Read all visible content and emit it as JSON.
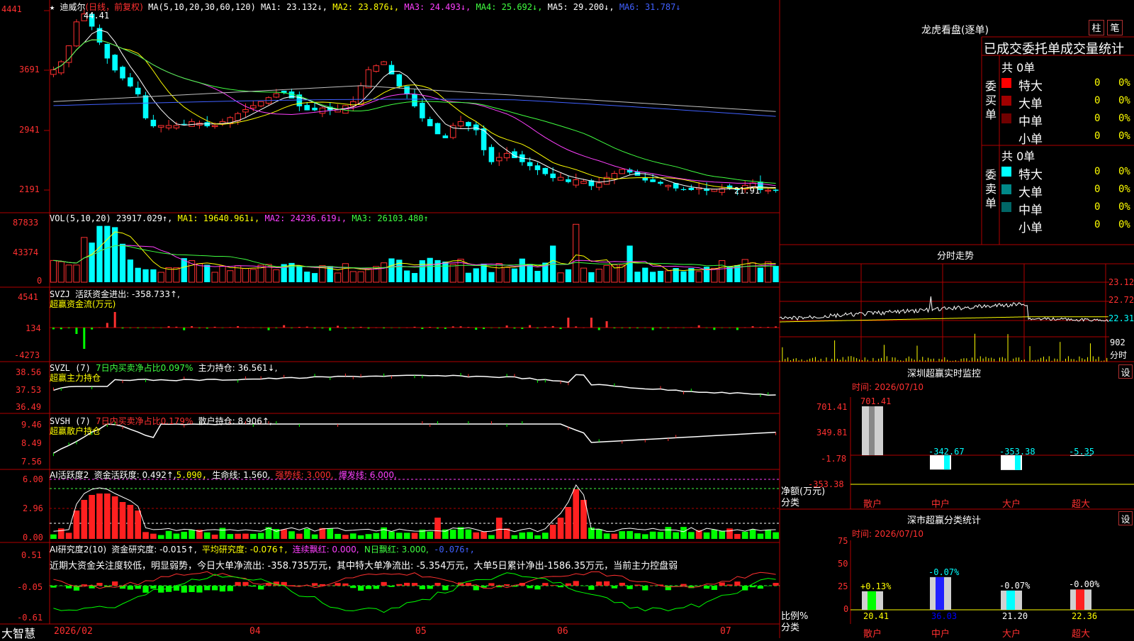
{
  "colors": {
    "up": "#ff3030",
    "down": "#00ffff",
    "grid": "#b00000",
    "bg": "#000000"
  },
  "kline": {
    "header": {
      "star": "★",
      "name": "迪威尔",
      "period": "(日线，前复权)",
      "ma_title": "MA(5,10,20,30,60,120)",
      "ma1": "MA1: 23.132↓,",
      "ma2": "MA2: 23.876↓,",
      "ma3": "MA3: 24.493↓,",
      "ma4": "MA4: 25.692↓,",
      "ma5": "MA5: 29.200↓,",
      "ma6": "MA6: 31.787↓"
    },
    "y_ticks": [
      "4441",
      "3691",
      "2941",
      "2191"
    ],
    "max_label": "44.41",
    "min_label": "21.91"
  },
  "vol": {
    "title": "VOL(5,10,20)",
    "v": "23917.029↑,",
    "ma1": "MA1: 19640.961↓,",
    "ma2": "MA2: 24236.619↓,",
    "ma3": "MA3: 26103.480↑",
    "y_ticks": [
      "87833",
      "43374",
      "0"
    ]
  },
  "svzj": {
    "title": "SVZJ",
    "desc": "活跃资金进出: -358.733↑,",
    "sub": "超赢资金流(万元)",
    "y_ticks": [
      "4541",
      "134",
      "-4273"
    ]
  },
  "svzl": {
    "title": "SVZL (7)",
    "a": "7日内买卖净占比0.097%",
    "b": "主力持仓: 36.561↓,",
    "sub": "超赢主力持仓",
    "y_ticks": [
      "38.56",
      "37.53",
      "36.49"
    ]
  },
  "svsh": {
    "title": "SVSH (7)",
    "a": "7日内买卖净占比0.179%",
    "b": "散户持仓: 8.906↑,",
    "sub": "超赢散户持仓",
    "y_ticks": [
      "9.46",
      "8.49",
      "7.56"
    ]
  },
  "ai2": {
    "title": "AI活跃度2",
    "a": "资金活跃度: 0.492↑,",
    "b": "5.090,",
    "c": "生命线: 1.560,",
    "d": "强势线: 3.000,",
    "e": "爆发线: 6.000,",
    "y_ticks": [
      "6.00",
      "2.96",
      "0.00"
    ]
  },
  "ai_research": {
    "title": "AI研究度2(10)",
    "a": "资金研究度: -0.015↑,",
    "b": "平均研究度: -0.076↑,",
    "c": "连续飘红: 0.000,",
    "d": "N日飘红: 3.000,",
    "e": "-0.076↑,",
    "note": "近期大资金关注度较低，明显弱势，今日大单净流出: -358.735万元，其中特大单净流出: -5.354万元，大单5日累计净出-1586.35万元，当前主力控盘弱",
    "y_ticks": [
      "0.51",
      "-0.05",
      "-0.61"
    ]
  },
  "x_axis": {
    "labels": [
      "2026/02",
      "04",
      "05",
      "06",
      "07"
    ]
  },
  "brand": "大智慧",
  "dragon": {
    "title": "龙虎看盘(逐单)",
    "btn1": "柱",
    "btn2": "笔",
    "table_title": "已成交委托单成交量统计",
    "buy": {
      "side": "委买单",
      "total": "共 0单",
      "rows": [
        {
          "name": "特大",
          "v": "0",
          "p": "0%"
        },
        {
          "name": "大单",
          "v": "0",
          "p": "0%"
        },
        {
          "name": "中单",
          "v": "0",
          "p": "0%"
        },
        {
          "name": "小单",
          "v": "0",
          "p": "0%"
        }
      ]
    },
    "sell": {
      "side": "委卖单",
      "total": "共 0单",
      "rows": [
        {
          "name": "特大",
          "v": "0",
          "p": "0%"
        },
        {
          "name": "大单",
          "v": "0",
          "p": "0%"
        },
        {
          "name": "中单",
          "v": "0",
          "p": "0%"
        },
        {
          "name": "小单",
          "v": "0",
          "p": "0%"
        }
      ]
    }
  },
  "intraday": {
    "title": "分时走势",
    "ticks": [
      "23.12",
      "22.72",
      "22.31"
    ],
    "vol_tick": "902",
    "vol_label": "分时"
  },
  "monitor": {
    "title": "深圳超赢实时监控",
    "btn": "设",
    "time": "时间: 2026/07/10",
    "y_ticks": [
      "701.41",
      "349.81",
      "-1.78",
      "-353.38"
    ],
    "ylabel": "净额(万元)",
    "xlabel": "分类",
    "bars": [
      {
        "cat": "散户",
        "value": 701.41,
        "label": "701.41"
      },
      {
        "cat": "中户",
        "value": -342.67,
        "label": "-342.67"
      },
      {
        "cat": "大户",
        "value": -353.38,
        "label": "-353.38"
      },
      {
        "cat": "超大",
        "value": -5.35,
        "label": "-5.35"
      }
    ]
  },
  "classify": {
    "title": "深市超赢分类统计",
    "btn": "设",
    "time": "时间: 2026/07/10",
    "y_ticks": [
      "75",
      "50",
      "25",
      "0"
    ],
    "ylabel": "比例%",
    "xlabel": "分类",
    "bars": [
      {
        "cat": "散户",
        "value": 20.41,
        "top": "+0.13%",
        "bottom": "20.41",
        "color": "#00ff00"
      },
      {
        "cat": "中户",
        "value": 36.03,
        "top": "-0.07%",
        "bottom": "36.03",
        "color": "#2020ff"
      },
      {
        "cat": "大户",
        "value": 21.2,
        "top": "-0.07%",
        "bottom": "21.20",
        "color": "#00ffff"
      },
      {
        "cat": "超大",
        "value": 22.36,
        "top": "-0.00%",
        "bottom": "22.36",
        "color": "#ff2020"
      }
    ]
  }
}
